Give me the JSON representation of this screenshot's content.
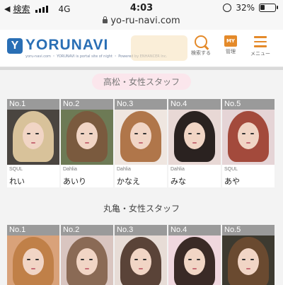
{
  "status_bar": {
    "back_arrow": "◀",
    "back_label": "検索",
    "network": "4G",
    "time": "4:03",
    "battery": "32%",
    "battery_level": 0.32
  },
  "url_bar": {
    "url": "yo-ru-navi.com"
  },
  "header": {
    "logo_mark": "Y",
    "logo_text": "YORUNAVI",
    "logo_sub": "yoru-navi.com ・ YORUNAVI is portal site of night ・ Powered by ENHANCER Inc.",
    "buttons": [
      {
        "label": "検索する",
        "icon": "search-icon"
      },
      {
        "label": "管理",
        "icon": "my-icon",
        "badge": "MY"
      },
      {
        "label": "メニュー",
        "icon": "menu-icon"
      }
    ]
  },
  "sections": [
    {
      "title": "高松・女性スタッフ",
      "staff": [
        {
          "rank": "No.1",
          "shop": "SQUL",
          "name": "れい"
        },
        {
          "rank": "No.2",
          "shop": "Dahlia",
          "name": "あいり"
        },
        {
          "rank": "No.3",
          "shop": "Dahlia",
          "name": "かなえ"
        },
        {
          "rank": "No.4",
          "shop": "Dahlia",
          "name": "みな"
        },
        {
          "rank": "No.5",
          "shop": "SQUL",
          "name": "あや"
        }
      ]
    },
    {
      "title": "丸亀・女性スタッフ",
      "staff": [
        {
          "rank": "No.1",
          "shop": "",
          "name": ""
        },
        {
          "rank": "No.2",
          "shop": "",
          "name": ""
        },
        {
          "rank": "No.3",
          "shop": "",
          "name": ""
        },
        {
          "rank": "No.4",
          "shop": "",
          "name": ""
        },
        {
          "rank": "No.5",
          "shop": "",
          "name": ""
        }
      ]
    }
  ]
}
